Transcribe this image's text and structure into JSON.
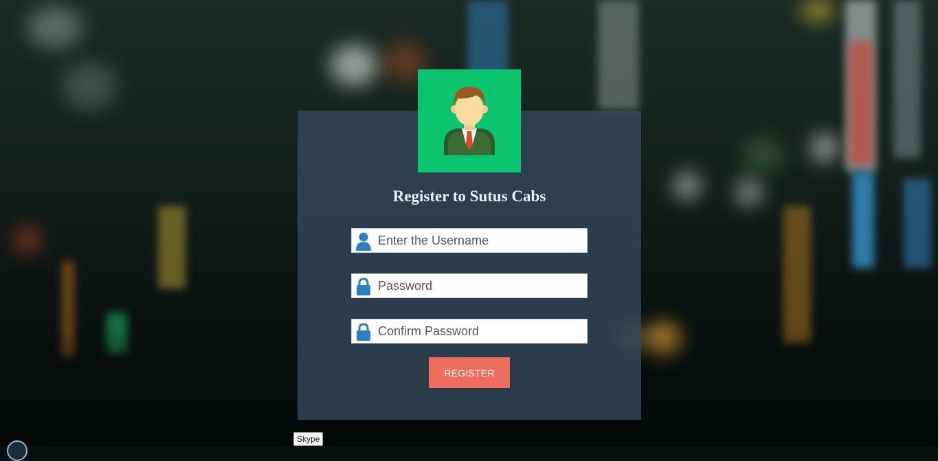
{
  "form": {
    "title": "Register to Sutus Cabs",
    "username_placeholder": "Enter the Username",
    "password_placeholder": "Password",
    "confirm_placeholder": "Confirm Password",
    "submit_label": "REGISTER"
  },
  "tooltip": {
    "text": "Skype"
  },
  "icons": {
    "avatar": "businessman-avatar-icon",
    "user": "user-icon",
    "lock": "lock-icon"
  },
  "colors": {
    "avatar_bg": "#0ac46e",
    "panel_bg": "#34495e",
    "button_bg": "#ec6c5e",
    "icon_blue": "#2e7fbf",
    "title_text": "#e6f2fb"
  }
}
